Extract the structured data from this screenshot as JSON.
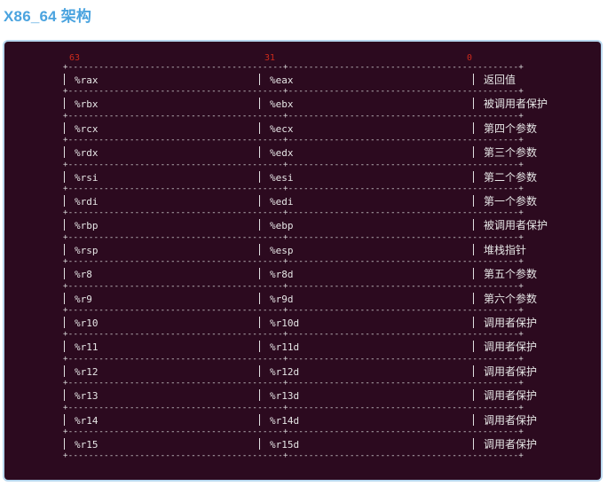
{
  "title": "X86_64 架构",
  "bits": {
    "high": "63",
    "mid": "31",
    "low": "0"
  },
  "rows": [
    {
      "r64": "%rax",
      "r32": "%eax",
      "desc": "返回值"
    },
    {
      "r64": "%rbx",
      "r32": "%ebx",
      "desc": "被调用者保护"
    },
    {
      "r64": "%rcx",
      "r32": "%ecx",
      "desc": "第四个参数"
    },
    {
      "r64": "%rdx",
      "r32": "%edx",
      "desc": "第三个参数"
    },
    {
      "r64": "%rsi",
      "r32": "%esi",
      "desc": "第二个参数"
    },
    {
      "r64": "%rdi",
      "r32": "%edi",
      "desc": "第一个参数"
    },
    {
      "r64": "%rbp",
      "r32": "%ebp",
      "desc": "被调用者保护"
    },
    {
      "r64": "%rsp",
      "r32": "%esp",
      "desc": "堆栈指针"
    },
    {
      "r64": "%r8",
      "r32": "%r8d",
      "desc": "第五个参数"
    },
    {
      "r64": "%r9",
      "r32": "%r9d",
      "desc": "第六个参数"
    },
    {
      "r64": "%r10",
      "r32": "%r10d",
      "desc": "调用者保护"
    },
    {
      "r64": "%r11",
      "r32": "%r11d",
      "desc": "调用者保护"
    },
    {
      "r64": "%r12",
      "r32": "%r12d",
      "desc": "调用者保护"
    },
    {
      "r64": "%r13",
      "r32": "%r13d",
      "desc": "调用者保护"
    },
    {
      "r64": "%r14",
      "r32": "%r14d",
      "desc": "调用者保护"
    },
    {
      "r64": "%r15",
      "r32": "%r15d",
      "desc": "调用者保护"
    }
  ]
}
